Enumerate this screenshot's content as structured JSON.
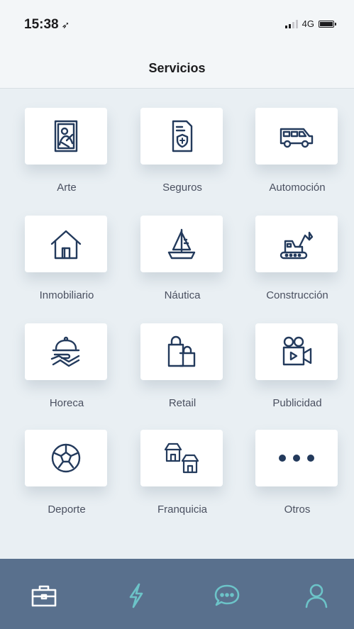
{
  "status_bar": {
    "time": "15:38",
    "network": "4G",
    "signal_bars": 4,
    "signal_active": 2,
    "battery_level": 1.0
  },
  "nav": {
    "title": "Servicios"
  },
  "services": [
    {
      "label": "Arte",
      "icon": "art-portrait-icon"
    },
    {
      "label": "Seguros",
      "icon": "insurance-document-icon"
    },
    {
      "label": "Automoción",
      "icon": "car-icon"
    },
    {
      "label": "Inmobiliario",
      "icon": "house-icon"
    },
    {
      "label": "Náutica",
      "icon": "sailboat-icon"
    },
    {
      "label": "Construcción",
      "icon": "excavator-icon"
    },
    {
      "label": "Horeca",
      "icon": "serving-tray-icon"
    },
    {
      "label": "Retail",
      "icon": "shopping-bags-icon"
    },
    {
      "label": "Publicidad",
      "icon": "video-camera-icon"
    },
    {
      "label": "Deporte",
      "icon": "soccer-ball-icon"
    },
    {
      "label": "Franquicia",
      "icon": "franchise-stores-icon"
    },
    {
      "label": "Otros",
      "icon": "more-dots-icon"
    }
  ],
  "tab_bar": {
    "items": [
      {
        "icon": "briefcase-icon",
        "active": true
      },
      {
        "icon": "lightning-icon",
        "active": false
      },
      {
        "icon": "chat-bubble-icon",
        "active": false
      },
      {
        "icon": "user-icon",
        "active": false
      }
    ]
  },
  "colors": {
    "icon_stroke": "#233a5c",
    "tab_bar_bg": "#59708d",
    "tab_active": "#ffffff",
    "tab_inactive": "#6cc3c8",
    "background": "#e9eff3"
  }
}
